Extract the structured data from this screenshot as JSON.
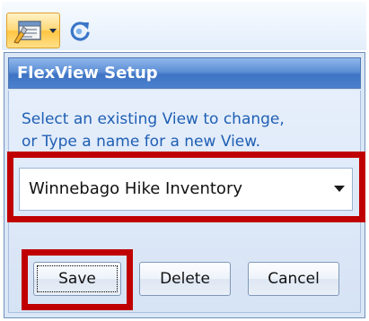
{
  "toolbar": {
    "form_dropdown_icon": "form-settings-icon",
    "dropdown_caret_icon": "chevron-down-icon",
    "refresh_icon": "refresh-icon"
  },
  "dialog": {
    "title": "FlexView Setup",
    "instructions": [
      "Select an existing View to change,",
      "or Type a name for a new View."
    ],
    "view_combo": {
      "value": "Winnebago Hike Inventory",
      "arrow_icon": "chevron-down-icon"
    },
    "buttons": {
      "save": "Save",
      "delete": "Delete",
      "cancel": "Cancel"
    }
  },
  "colors": {
    "highlight": "#c00000",
    "header": "#4a80cd",
    "instruction_text": "#1f5fb4"
  }
}
